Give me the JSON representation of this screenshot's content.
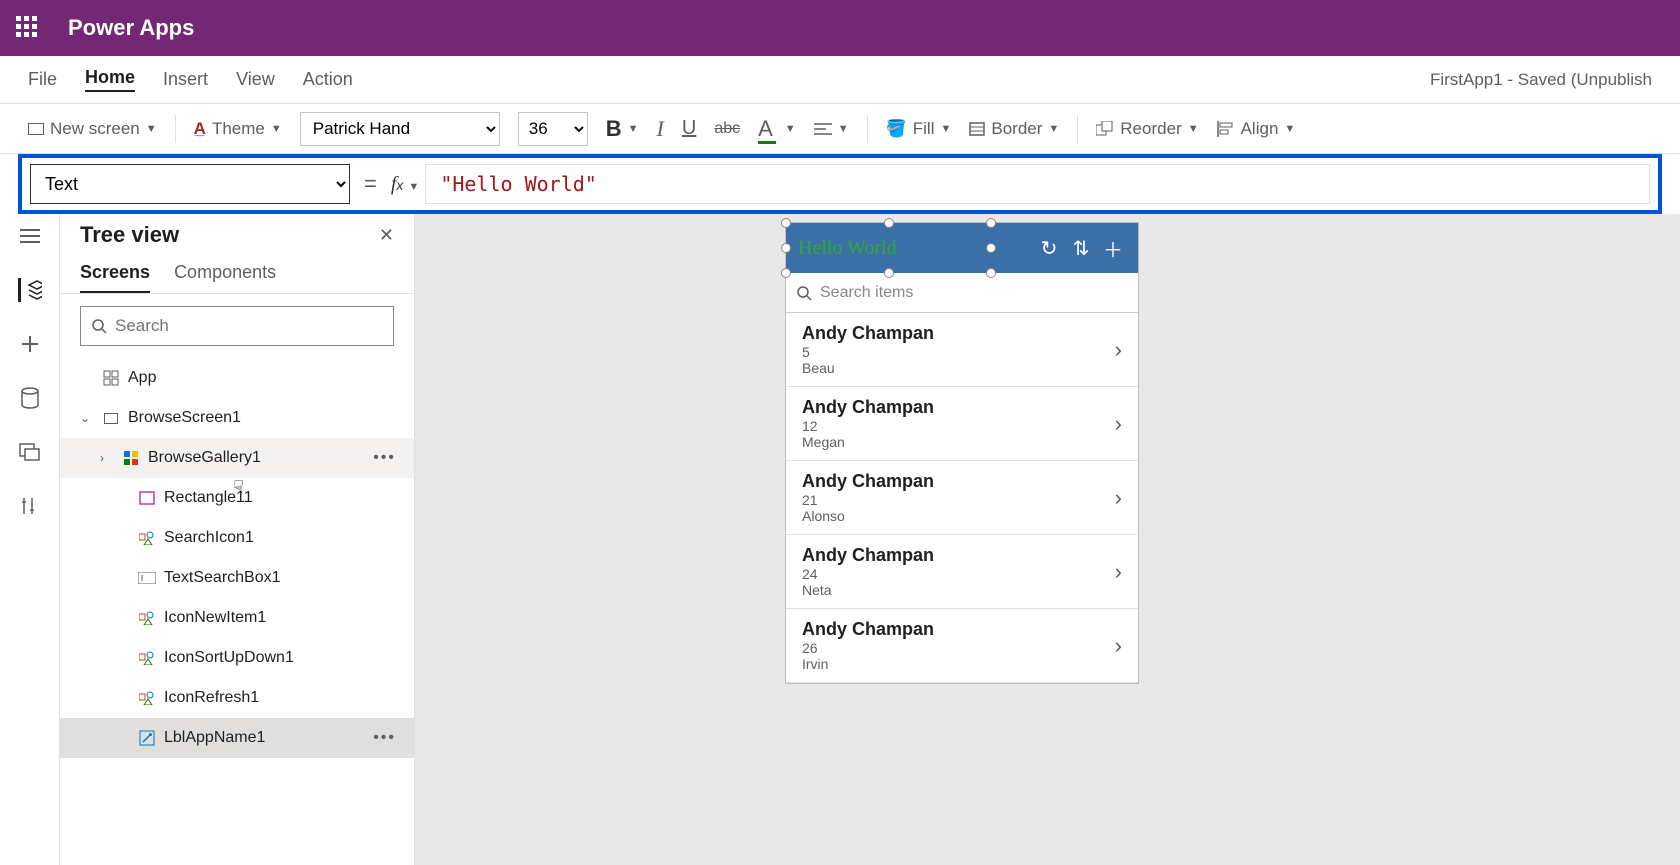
{
  "brand": "Power Apps",
  "menu": {
    "file": "File",
    "home": "Home",
    "insert": "Insert",
    "view": "View",
    "action": "Action"
  },
  "status": "FirstApp1 - Saved (Unpublish",
  "ribbon": {
    "newScreen": "New screen",
    "theme": "Theme",
    "font": "Patrick Hand",
    "size": "36",
    "fill": "Fill",
    "border": "Border",
    "reorder": "Reorder",
    "align": "Align"
  },
  "formula": {
    "property": "Text",
    "value": "\"Hello World\""
  },
  "tree": {
    "title": "Tree view",
    "tabScreens": "Screens",
    "tabComponents": "Components",
    "searchPlaceholder": "Search",
    "items": {
      "app": "App",
      "screen": "BrowseScreen1",
      "gallery": "BrowseGallery1",
      "rect": "Rectangle11",
      "searchIcon": "SearchIcon1",
      "textBox": "TextSearchBox1",
      "newItem": "IconNewItem1",
      "sort": "IconSortUpDown1",
      "refresh": "IconRefresh1",
      "lbl": "LblAppName1"
    }
  },
  "preview": {
    "headerText": "Hello World",
    "searchPlaceholder": "Search items",
    "rows": [
      {
        "name": "Andy Champan",
        "num": "5",
        "sub": "Beau"
      },
      {
        "name": "Andy Champan",
        "num": "12",
        "sub": "Megan"
      },
      {
        "name": "Andy Champan",
        "num": "21",
        "sub": "Alonso"
      },
      {
        "name": "Andy Champan",
        "num": "24",
        "sub": "Neta"
      },
      {
        "name": "Andy Champan",
        "num": "26",
        "sub": "Irvin"
      }
    ]
  }
}
